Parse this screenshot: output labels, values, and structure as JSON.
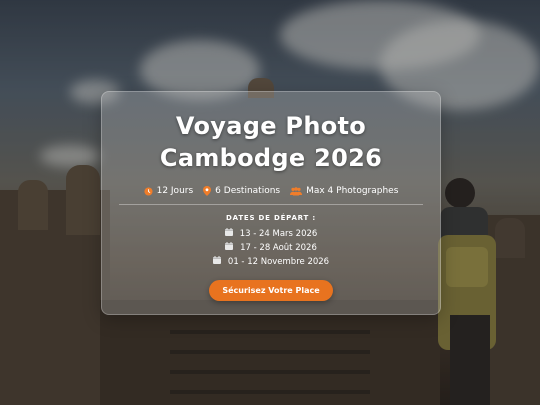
{
  "hero": {
    "title_line1": "Voyage Photo",
    "title_line2": "Cambodge 2026",
    "stats": [
      {
        "icon": "clock-icon",
        "label": "12 Jours"
      },
      {
        "icon": "map-pin-icon",
        "label": "6 Destinations"
      },
      {
        "icon": "users-icon",
        "label": "Max 4 Photographes"
      }
    ],
    "dates_label": "DATES DE DÉPART :",
    "dates": [
      "13 - 24 Mars 2026",
      "17 - 28 Août 2026",
      "01 - 12 Novembre 2026"
    ],
    "cta_label": "Sécurisez Votre Place"
  },
  "colors": {
    "accent": "#e8731f"
  }
}
